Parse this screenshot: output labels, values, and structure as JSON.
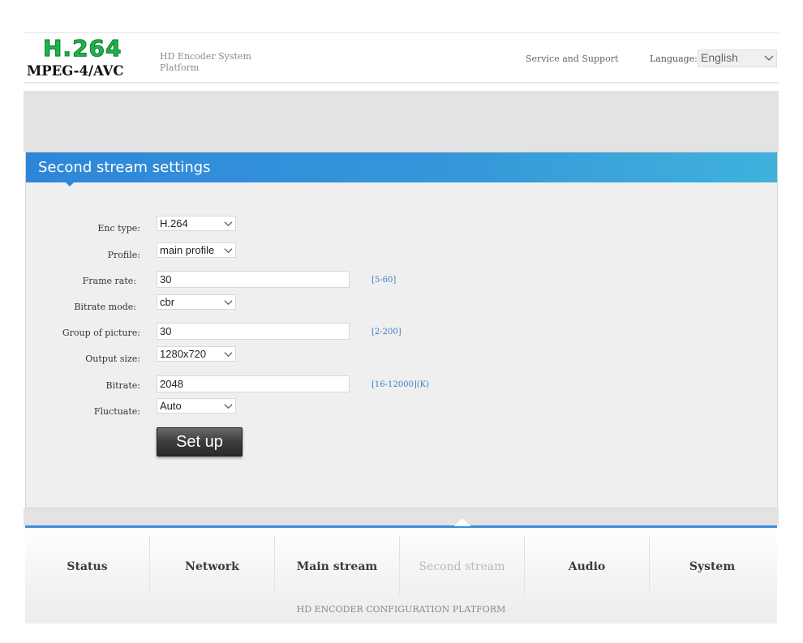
{
  "header": {
    "logo_top": "H.264",
    "logo_bottom": "MPEG-4/AVC",
    "system_title": "HD Encoder System Platform",
    "service_link": "Service and Support",
    "language_label": "Language:",
    "language_value": "English"
  },
  "panel": {
    "title": "Second stream settings",
    "fields": {
      "enc_type": {
        "label": "Enc type:",
        "value": "H.264"
      },
      "profile": {
        "label": "Profile:",
        "value": "main profile"
      },
      "frame_rate": {
        "label": "Frame rate:",
        "value": "30",
        "hint": "[5-60]"
      },
      "bitrate_mode": {
        "label": "Bitrate mode:",
        "value": "cbr"
      },
      "gop": {
        "label": "Group of picture:",
        "value": "30",
        "hint": "[2-200]"
      },
      "output_size": {
        "label": "Output size:",
        "value": "1280x720"
      },
      "bitrate": {
        "label": "Bitrate:",
        "value": "2048",
        "hint": "[16-12000](K)"
      },
      "fluctuate": {
        "label": "Fluctuate:",
        "value": "Auto"
      }
    },
    "setup_button": "Set up"
  },
  "nav": {
    "items": [
      "Status",
      "Network",
      "Main stream",
      "Second stream",
      "Audio",
      "System"
    ],
    "active": "Second stream"
  },
  "footer": "HD ENCODER CONFIGURATION PLATFORM",
  "colors": {
    "accent_blue": "#3596da",
    "logo_green": "#1fb34a",
    "hint_blue": "#3a80c8"
  }
}
